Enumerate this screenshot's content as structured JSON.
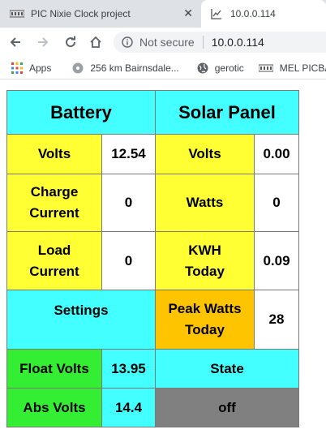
{
  "browser": {
    "tabs": [
      {
        "title": "PIC Nixie Clock project",
        "favicon": "pic-logo-icon",
        "active": false
      },
      {
        "title": "10.0.0.114",
        "favicon": "chart-icon",
        "active": true
      }
    ],
    "omnibox": {
      "security_text": "Not secure",
      "url": "10.0.0.114"
    },
    "bookmarks": [
      {
        "label": "Apps",
        "icon": "apps-grid-icon"
      },
      {
        "label": "256 km Bairnsdale...",
        "icon": "disc-icon"
      },
      {
        "label": "gerotic",
        "icon": "globe-icon"
      },
      {
        "label": "MEL PICBAS",
        "icon": "pic-logo-icon"
      }
    ]
  },
  "battery": {
    "title": "Battery",
    "volts_label": "Volts",
    "volts_value": "12.54",
    "charge_label_1": "Charge",
    "charge_label_2": "Current",
    "charge_value": "0",
    "load_label_1": "Load",
    "load_label_2": "Current",
    "load_value": "0"
  },
  "solar": {
    "title": "Solar Panel",
    "volts_label": "Volts",
    "volts_value": "0.00",
    "watts_label": "Watts",
    "watts_value": "0",
    "kwh_label_1": "KWH",
    "kwh_label_2": "Today",
    "kwh_value": "0.09",
    "peak_label_1": "Peak Watts",
    "peak_label_2": "Today",
    "peak_value": "28"
  },
  "settings": {
    "title": "Settings",
    "float_label": "Float Volts",
    "float_value": "13.95",
    "abs_label": "Abs Volts",
    "abs_value": "14.4"
  },
  "state": {
    "label": "State",
    "value": "off"
  },
  "colors": {
    "header": "#44ffff",
    "label": "#ffff33",
    "peak": "#ffc400",
    "settings_label": "#33ee33",
    "state_off": "#808080"
  }
}
